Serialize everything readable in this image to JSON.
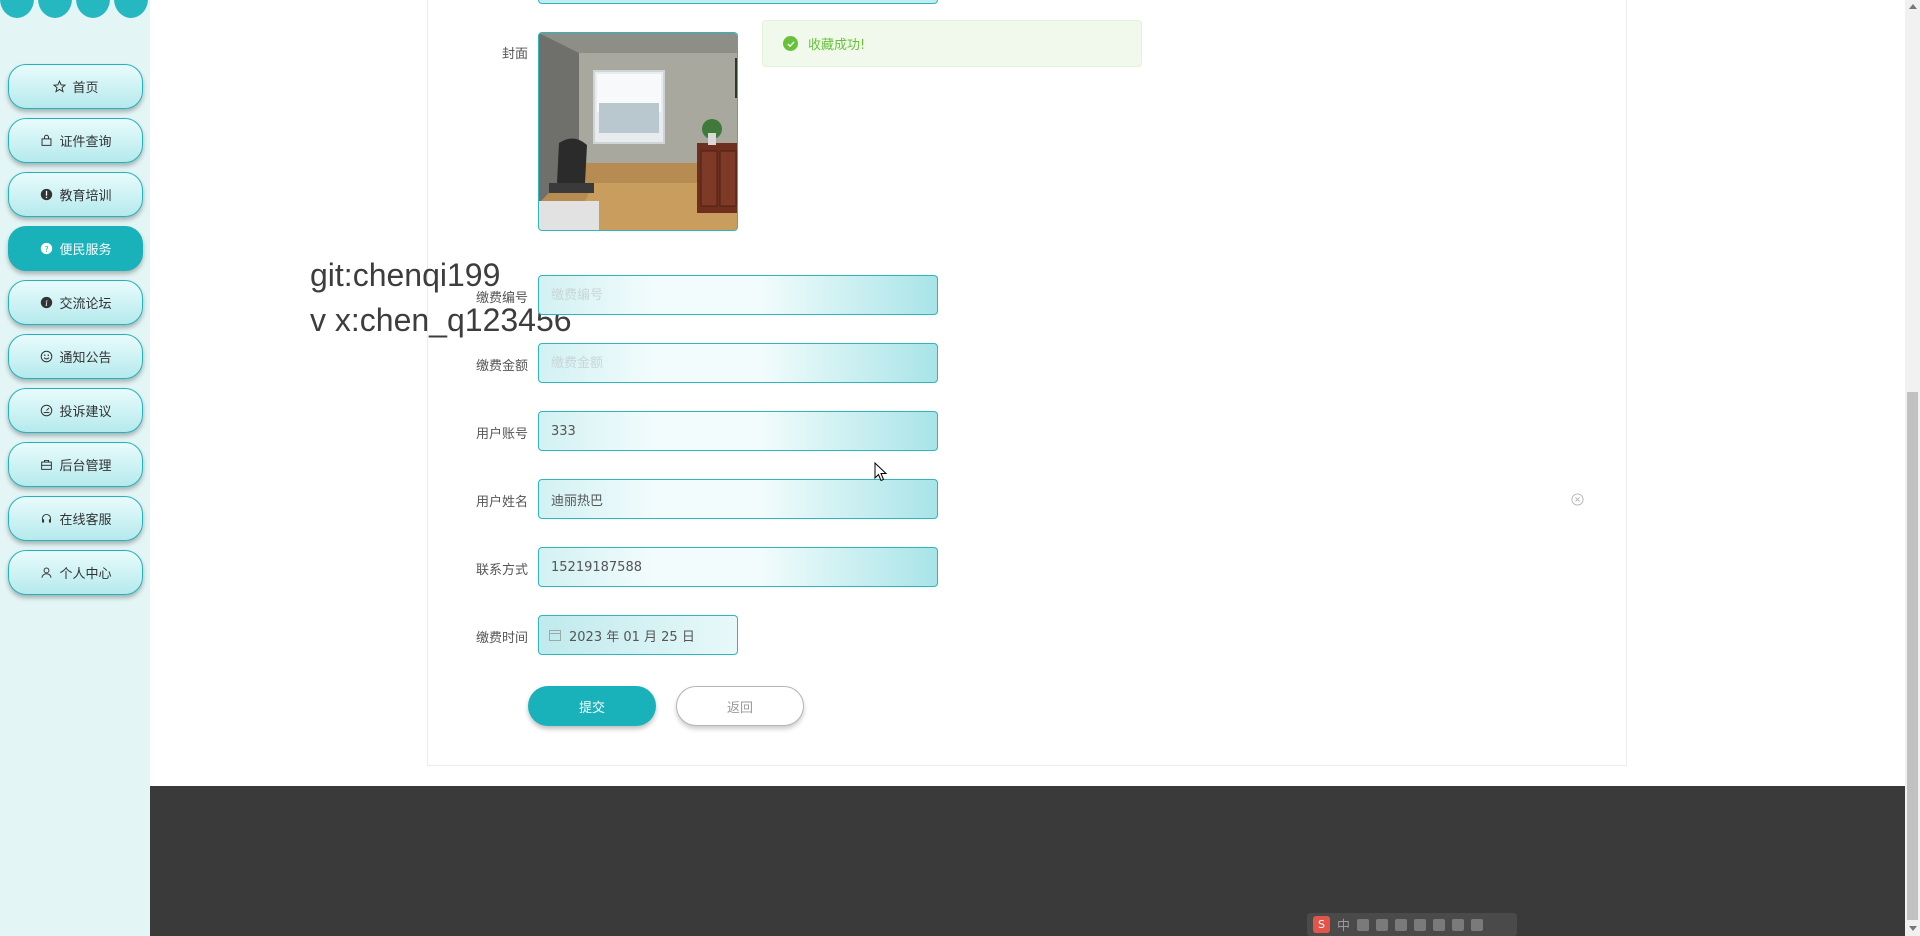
{
  "sidebar": {
    "items": [
      {
        "label": "首页",
        "icon": "star-icon"
      },
      {
        "label": "证件查询",
        "icon": "bag-icon"
      },
      {
        "label": "教育培训",
        "icon": "alert-circle-icon"
      },
      {
        "label": "便民服务",
        "icon": "question-circle-icon",
        "active": true
      },
      {
        "label": "交流论坛",
        "icon": "info-circle-icon"
      },
      {
        "label": "通知公告",
        "icon": "smile-icon"
      },
      {
        "label": "投诉建议",
        "icon": "dial-icon"
      },
      {
        "label": "后台管理",
        "icon": "box-icon"
      },
      {
        "label": "在线客服",
        "icon": "headset-icon"
      },
      {
        "label": "个人中心",
        "icon": "user-icon"
      }
    ]
  },
  "form": {
    "cover_label": "封面",
    "fee_no_label": "缴费编号",
    "fee_no_placeholder": "缴费编号",
    "fee_amount_label": "缴费金额",
    "fee_amount_placeholder": "缴费金额",
    "user_account_label": "用户账号",
    "user_account_value": "333",
    "user_name_label": "用户姓名",
    "user_name_value": "迪丽热巴",
    "contact_label": "联系方式",
    "contact_value": "15219187588",
    "pay_time_label": "缴费时间",
    "pay_time_value": "2023 年 01 月 25 日",
    "submit_label": "提交",
    "back_label": "返回"
  },
  "toast": {
    "message": "收藏成功!"
  },
  "watermark": {
    "line1": "git:chenqi199",
    "line2": "v x:chen_q123456"
  },
  "ime": {
    "lang": "中"
  },
  "colors": {
    "accent": "#19b2ba",
    "toast_bg": "#f0f9eb",
    "toast_text": "#67c23a",
    "footer": "#3a3a3a"
  }
}
